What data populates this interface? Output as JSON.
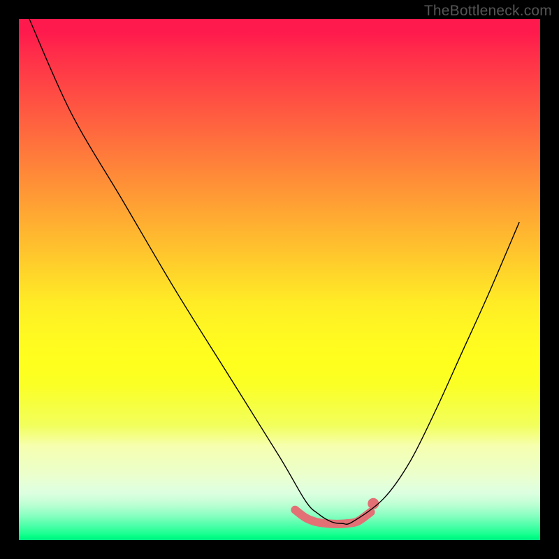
{
  "watermark": "TheBottleneck.com",
  "colors": {
    "curve": "#000000",
    "bump": "#e27075",
    "frame": "#000000"
  },
  "chart_data": {
    "type": "line",
    "title": "",
    "xlabel": "",
    "ylabel": "",
    "xlim": [
      0,
      100
    ],
    "ylim": [
      0,
      100
    ],
    "series": [
      {
        "name": "bottleneck-curve",
        "x": [
          2,
          10,
          20,
          30,
          40,
          50,
          55,
          57.5,
          60,
          62,
          64,
          70,
          75,
          80,
          85,
          90,
          96
        ],
        "y": [
          100,
          82,
          65,
          48,
          32,
          16,
          7.5,
          5,
          3.5,
          3.2,
          3.5,
          8,
          15,
          25,
          36,
          47,
          61
        ]
      },
      {
        "name": "optimal-bump",
        "x": [
          53,
          55,
          57,
          59,
          61,
          63,
          65,
          67.5
        ],
        "y": [
          5.8,
          4.3,
          3.5,
          3.2,
          3.1,
          3.2,
          3.6,
          5.4
        ]
      }
    ],
    "marker": {
      "x": 68,
      "y": 7.0
    },
    "background_gradient": {
      "type": "vertical",
      "stops": [
        {
          "pos": 0,
          "color": "#ff1a4d"
        },
        {
          "pos": 50,
          "color": "#ffda29"
        },
        {
          "pos": 78,
          "color": "#f2ff5c"
        },
        {
          "pos": 100,
          "color": "#00ec82"
        }
      ]
    }
  }
}
